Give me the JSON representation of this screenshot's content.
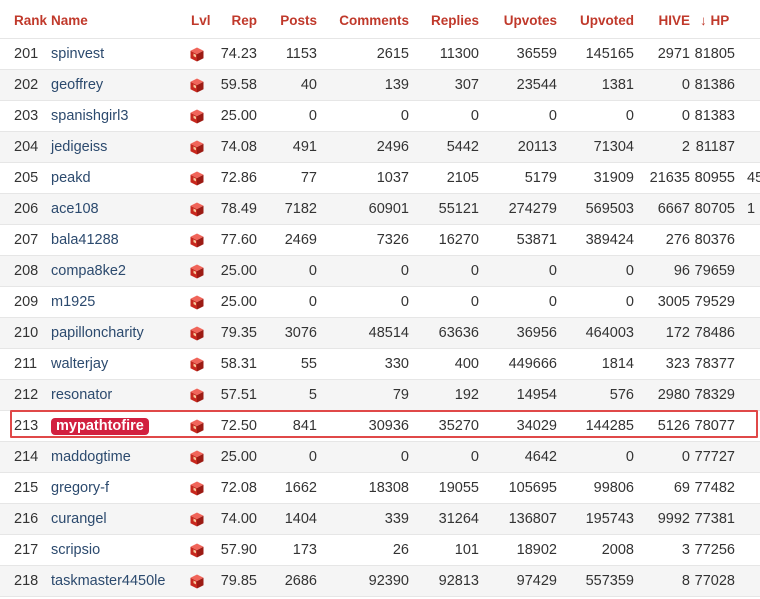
{
  "columns": {
    "rank": "Rank",
    "name": "Name",
    "lvl": "Lvl",
    "rep": "Rep",
    "posts": "Posts",
    "comments": "Comments",
    "replies": "Replies",
    "upvotes": "Upvotes",
    "upvoted": "Upvoted",
    "hive": "HIVE",
    "hp_arrow": "↓",
    "hp": "HP"
  },
  "level_icon": "red-cube-icon",
  "highlight_color": "#e04848",
  "badge_color": "#d2203f",
  "rows": [
    {
      "rank": "201",
      "name": "spinvest",
      "rep": "74.23",
      "posts": "1153",
      "comments": "2615",
      "replies": "11300",
      "upvotes": "36559",
      "upvoted": "145165",
      "hive": "2971",
      "hp": "81805",
      "extra": ""
    },
    {
      "rank": "202",
      "name": "geoffrey",
      "rep": "59.58",
      "posts": "40",
      "comments": "139",
      "replies": "307",
      "upvotes": "23544",
      "upvoted": "1381",
      "hive": "0",
      "hp": "81386",
      "extra": ""
    },
    {
      "rank": "203",
      "name": "spanishgirl3",
      "rep": "25.00",
      "posts": "0",
      "comments": "0",
      "replies": "0",
      "upvotes": "0",
      "upvoted": "0",
      "hive": "0",
      "hp": "81383",
      "extra": ""
    },
    {
      "rank": "204",
      "name": "jedigeiss",
      "rep": "74.08",
      "posts": "491",
      "comments": "2496",
      "replies": "5442",
      "upvotes": "20113",
      "upvoted": "71304",
      "hive": "2",
      "hp": "81187",
      "extra": ""
    },
    {
      "rank": "205",
      "name": "peakd",
      "rep": "72.86",
      "posts": "77",
      "comments": "1037",
      "replies": "2105",
      "upvotes": "5179",
      "upvoted": "31909",
      "hive": "21635",
      "hp": "80955",
      "extra": "45"
    },
    {
      "rank": "206",
      "name": "ace108",
      "rep": "78.49",
      "posts": "7182",
      "comments": "60901",
      "replies": "55121",
      "upvotes": "274279",
      "upvoted": "569503",
      "hive": "6667",
      "hp": "80705",
      "extra": "1"
    },
    {
      "rank": "207",
      "name": "bala41288",
      "rep": "77.60",
      "posts": "2469",
      "comments": "7326",
      "replies": "16270",
      "upvotes": "53871",
      "upvoted": "389424",
      "hive": "276",
      "hp": "80376",
      "extra": ""
    },
    {
      "rank": "208",
      "name": "compa8ke2",
      "rep": "25.00",
      "posts": "0",
      "comments": "0",
      "replies": "0",
      "upvotes": "0",
      "upvoted": "0",
      "hive": "96",
      "hp": "79659",
      "extra": ""
    },
    {
      "rank": "209",
      "name": "m1925",
      "rep": "25.00",
      "posts": "0",
      "comments": "0",
      "replies": "0",
      "upvotes": "0",
      "upvoted": "0",
      "hive": "3005",
      "hp": "79529",
      "extra": ""
    },
    {
      "rank": "210",
      "name": "papilloncharity",
      "rep": "79.35",
      "posts": "3076",
      "comments": "48514",
      "replies": "63636",
      "upvotes": "36956",
      "upvoted": "464003",
      "hive": "172",
      "hp": "78486",
      "extra": ""
    },
    {
      "rank": "211",
      "name": "walterjay",
      "rep": "58.31",
      "posts": "55",
      "comments": "330",
      "replies": "400",
      "upvotes": "449666",
      "upvoted": "1814",
      "hive": "323",
      "hp": "78377",
      "extra": ""
    },
    {
      "rank": "212",
      "name": "resonator",
      "rep": "57.51",
      "posts": "5",
      "comments": "79",
      "replies": "192",
      "upvotes": "14954",
      "upvoted": "576",
      "hive": "2980",
      "hp": "78329",
      "extra": ""
    },
    {
      "rank": "213",
      "name": "mypathtofire",
      "rep": "72.50",
      "posts": "841",
      "comments": "30936",
      "replies": "35270",
      "upvotes": "34029",
      "upvoted": "144285",
      "hive": "5126",
      "hp": "78077",
      "extra": "",
      "highlight": true
    },
    {
      "rank": "214",
      "name": "maddogtime",
      "rep": "25.00",
      "posts": "0",
      "comments": "0",
      "replies": "0",
      "upvotes": "4642",
      "upvoted": "0",
      "hive": "0",
      "hp": "77727",
      "extra": ""
    },
    {
      "rank": "215",
      "name": "gregory-f",
      "rep": "72.08",
      "posts": "1662",
      "comments": "18308",
      "replies": "19055",
      "upvotes": "105695",
      "upvoted": "99806",
      "hive": "69",
      "hp": "77482",
      "extra": ""
    },
    {
      "rank": "216",
      "name": "curangel",
      "rep": "74.00",
      "posts": "1404",
      "comments": "339",
      "replies": "31264",
      "upvotes": "136807",
      "upvoted": "195743",
      "hive": "9992",
      "hp": "77381",
      "extra": ""
    },
    {
      "rank": "217",
      "name": "scripsio",
      "rep": "57.90",
      "posts": "173",
      "comments": "26",
      "replies": "101",
      "upvotes": "18902",
      "upvoted": "2008",
      "hive": "3",
      "hp": "77256",
      "extra": ""
    },
    {
      "rank": "218",
      "name": "taskmaster4450le",
      "rep": "79.85",
      "posts": "2686",
      "comments": "92390",
      "replies": "92813",
      "upvotes": "97429",
      "upvoted": "557359",
      "hive": "8",
      "hp": "77028",
      "extra": ""
    }
  ]
}
